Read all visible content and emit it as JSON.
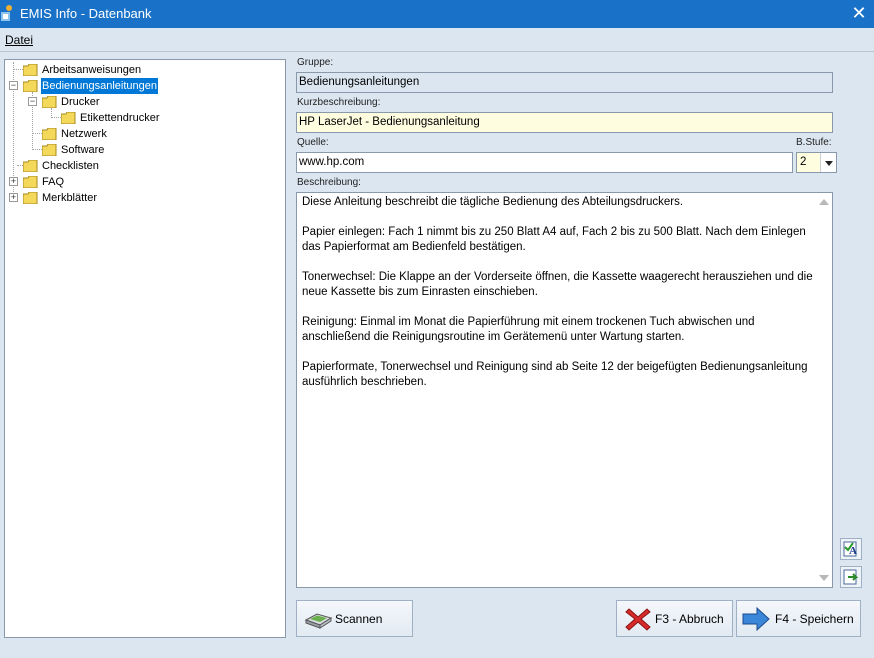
{
  "window": {
    "title": "EMIS Info - Datenbank"
  },
  "menu": {
    "datei": "Datei"
  },
  "tree": {
    "items": [
      {
        "label": "Arbeitsanweisungen"
      },
      {
        "label": "Bedienungsanleitungen"
      },
      {
        "label": "Drucker"
      },
      {
        "label": "Etikettendrucker"
      },
      {
        "label": "Netzwerk"
      },
      {
        "label": "Software"
      },
      {
        "label": "Checklisten"
      },
      {
        "label": "FAQ"
      },
      {
        "label": "Merkblätter"
      }
    ],
    "selected": "Bedienungsanleitungen"
  },
  "form": {
    "gruppe_label": "Gruppe:",
    "gruppe_value": "Bedienungsanleitungen",
    "kurz_label": "Kurzbeschreibung:",
    "kurz_value": "HP LaserJet - Bedienungsanleitung",
    "quelle_label": "Quelle:",
    "quelle_value": "www.hp.com",
    "bstufe_label": "B.Stufe:",
    "bstufe_value": "2",
    "beschreibung_label": "Beschreibung:",
    "beschreibung_paragraphs": [
      "Diese Anleitung beschreibt die tägliche Bedienung des Abteilungsdruckers.",
      "Papier einlegen: Fach 1 nimmt bis zu 250 Blatt A4 auf, Fach 2 bis zu 500 Blatt. Nach dem Einlegen das Papierformat am Bedienfeld bestätigen.",
      "Tonerwechsel: Die Klappe an der Vorderseite öffnen, die Kassette waagerecht herausziehen und die neue Kassette bis zum Einrasten einschieben.",
      "Reinigung: Einmal im Monat die Papierführung mit einem trockenen Tuch abwischen und anschließend die Reinigungsroutine im Gerätemenü unter Wartung starten.",
      "Papierformate, Tonerwechsel und Reinigung sind ab Seite 12 der beigefügten Bedienungsanleitung ausführlich beschrieben."
    ]
  },
  "buttons": {
    "scannen": "Scannen",
    "abbruch": "F3 - Abbruch",
    "speichern": "F4 - Speichern"
  },
  "icons": {
    "app": "app-logo-icon",
    "close": "close-icon",
    "folder": "folder-icon",
    "spellcheck": "spellcheck-icon",
    "export": "export-icon",
    "scanner": "scanner-icon",
    "cancel": "red-x-icon",
    "save": "blue-arrow-icon"
  },
  "colors": {
    "titlebar": "#1a72c8",
    "window_bg": "#dce6f0",
    "selection": "#0078d7",
    "field_yellow": "#fffde0"
  }
}
